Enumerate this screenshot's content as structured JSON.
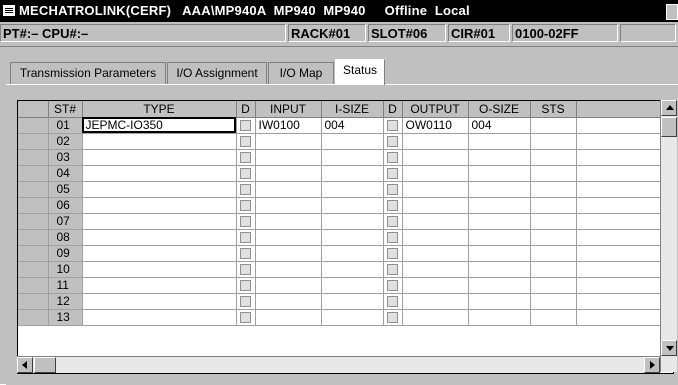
{
  "window": {
    "title": "MECHATROLINK(CERF)   AAA\\MP940A  MP940  MP940     Offline  Local"
  },
  "infobar": {
    "pt_cpu": "PT#:– CPU#:–",
    "rack": "RACK#01",
    "slot": "SLOT#06",
    "cir": "CIR#01",
    "range": "0100-02FF",
    "extra": ""
  },
  "tabs": [
    {
      "label": "Transmission Parameters"
    },
    {
      "label": "I/O Assignment"
    },
    {
      "label": "I/O Map"
    },
    {
      "label": "Status"
    }
  ],
  "table": {
    "headers": {
      "st": "ST#",
      "type": "TYPE",
      "d1": "D",
      "input": "INPUT",
      "isize": "I-SIZE",
      "d2": "D",
      "output": "OUTPUT",
      "osize": "O-SIZE",
      "sts": "STS",
      "extra": ""
    },
    "rows": [
      {
        "st": "01",
        "type": "JEPMC-IO350",
        "input": "IW0100",
        "isize": "004",
        "output": "OW0110",
        "osize": "004",
        "sts": ""
      },
      {
        "st": "02",
        "type": "",
        "input": "",
        "isize": "",
        "output": "",
        "osize": "",
        "sts": ""
      },
      {
        "st": "03",
        "type": "",
        "input": "",
        "isize": "",
        "output": "",
        "osize": "",
        "sts": ""
      },
      {
        "st": "04",
        "type": "",
        "input": "",
        "isize": "",
        "output": "",
        "osize": "",
        "sts": ""
      },
      {
        "st": "05",
        "type": "",
        "input": "",
        "isize": "",
        "output": "",
        "osize": "",
        "sts": ""
      },
      {
        "st": "06",
        "type": "",
        "input": "",
        "isize": "",
        "output": "",
        "osize": "",
        "sts": ""
      },
      {
        "st": "07",
        "type": "",
        "input": "",
        "isize": "",
        "output": "",
        "osize": "",
        "sts": ""
      },
      {
        "st": "08",
        "type": "",
        "input": "",
        "isize": "",
        "output": "",
        "osize": "",
        "sts": ""
      },
      {
        "st": "09",
        "type": "",
        "input": "",
        "isize": "",
        "output": "",
        "osize": "",
        "sts": ""
      },
      {
        "st": "10",
        "type": "",
        "input": "",
        "isize": "",
        "output": "",
        "osize": "",
        "sts": ""
      },
      {
        "st": "11",
        "type": "",
        "input": "",
        "isize": "",
        "output": "",
        "osize": "",
        "sts": ""
      },
      {
        "st": "12",
        "type": "",
        "input": "",
        "isize": "",
        "output": "",
        "osize": "",
        "sts": ""
      },
      {
        "st": "13",
        "type": "",
        "input": "",
        "isize": "",
        "output": "",
        "osize": "",
        "sts": ""
      }
    ]
  },
  "colors": {
    "titlebar": "#000000",
    "window_bg": "#c0c0c0",
    "grid_bg": "#ffffff"
  }
}
